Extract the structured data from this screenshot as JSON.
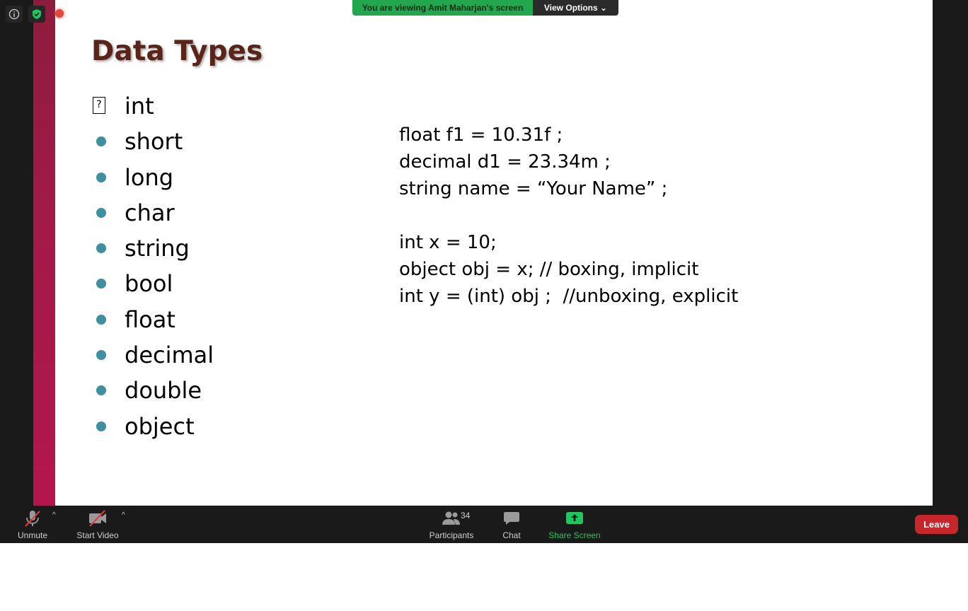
{
  "banner": {
    "viewing_text": "You are viewing Amit Maharjan's screen",
    "view_options_label": "View Options",
    "accent_color": "#23a74e"
  },
  "slide": {
    "title": "Data Types",
    "bullets": [
      "int",
      "short",
      "long",
      "char",
      "string",
      "bool",
      "float",
      "decimal",
      "double",
      "object"
    ],
    "first_bullet_glyph": "?",
    "code_lines_group1": [
      "float f1 = 10.31f ;",
      "decimal d1 = 23.34m ;",
      "string name = “Your Name” ;"
    ],
    "code_lines_group2": [
      "int x = 10;",
      "object obj = x; // boxing, implicit",
      "int y = (int) obj ;  //unboxing, explicit"
    ],
    "title_color": "#5b2418",
    "bullet_color": "#3f8fa0"
  },
  "top_icons": [
    "info-icon",
    "shield-check-icon",
    "recording-dot-icon"
  ],
  "toolbar": {
    "unmute_label": "Unmute",
    "start_video_label": "Start Video",
    "participants_label": "Participants",
    "participants_count": "34",
    "chat_label": "Chat",
    "share_screen_label": "Share Screen",
    "leave_label": "Leave",
    "leave_color": "#c7262a",
    "share_color": "#22c55e"
  }
}
